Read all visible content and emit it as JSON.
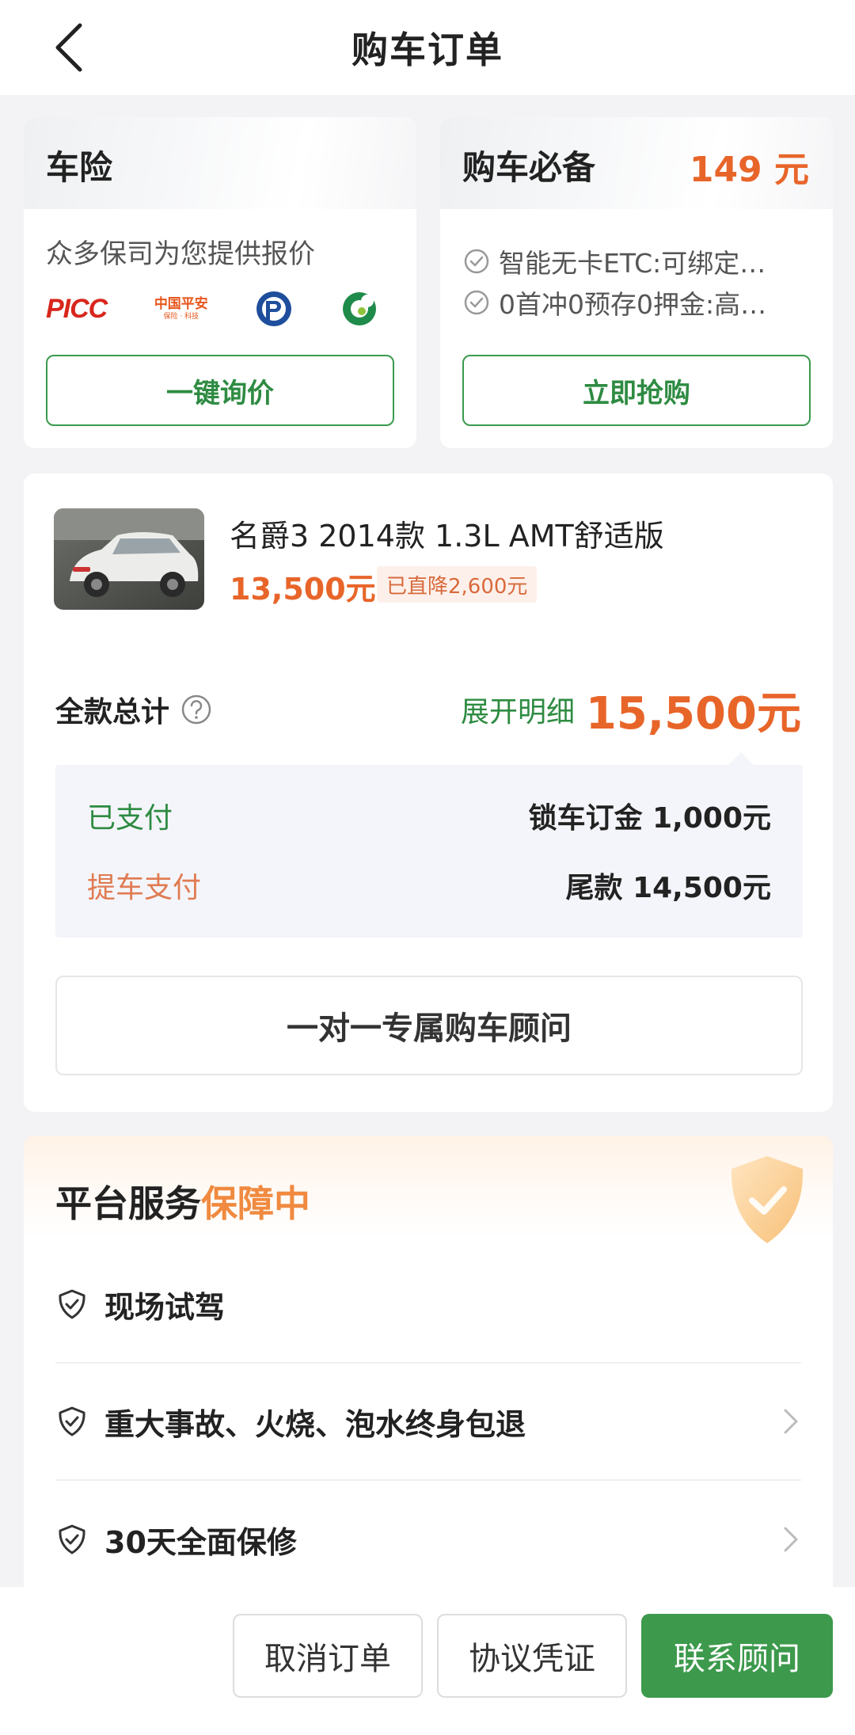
{
  "header": {
    "title": "购车订单"
  },
  "insurance": {
    "title": "车险",
    "subtitle": "众多保司为您提供报价",
    "logos": {
      "picc": "PICC",
      "pingan": "中国平安",
      "pingan_sub": "保险 · 科技"
    },
    "button": "一键询价"
  },
  "essentials": {
    "title": "购车必备",
    "price": "149 元",
    "perks": [
      "智能无卡ETC:可绑定…",
      "0首冲0预存0押金:高…"
    ],
    "button": "立即抢购"
  },
  "order": {
    "car_name": "名爵3 2014款 1.3L AMT舒适版",
    "car_price": "13,500元",
    "discount": "已直降2,600元",
    "total_label": "全款总计",
    "expand_label": "展开明细",
    "total_price": "15,500元",
    "paid_label": "已支付",
    "paid_value": "锁车订金 1,000元",
    "pickup_label": "提车支付",
    "pickup_value": "尾款 14,500元",
    "advisor_button": "一对一专属购车顾问"
  },
  "service": {
    "title_main": "平台服务",
    "title_accent": "保障中",
    "items": [
      "现场试驾",
      "重大事故、火烧、泡水终身包退",
      "30天全面保修"
    ]
  },
  "bottom_bar": {
    "cancel": "取消订单",
    "agreement": "协议凭证",
    "contact": "联系顾问"
  },
  "colors": {
    "accent_orange": "#e8652a",
    "brand_green": "#3d9a4c"
  }
}
